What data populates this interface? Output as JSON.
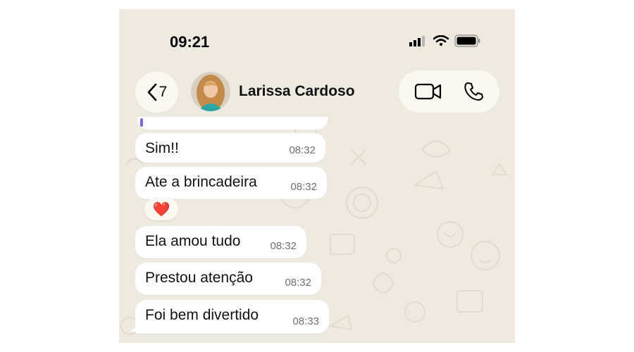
{
  "status_bar": {
    "time": "09:21"
  },
  "header": {
    "back_count": "7",
    "contact_name": "Larissa Cardoso"
  },
  "messages": [
    {
      "text": "Sim!!",
      "time": "08:32"
    },
    {
      "text": "Ate a brincadeira",
      "time": "08:32",
      "reaction": "❤️"
    },
    {
      "text": "Ela amou tudo",
      "time": "08:32"
    },
    {
      "text": "Prestou atenção",
      "time": "08:32"
    },
    {
      "text": "Foi bem divertido",
      "time": "08:33"
    }
  ],
  "colors": {
    "chat_background": "#efeae0",
    "bubble": "#ffffff",
    "header_pill": "#fbf8f2"
  }
}
